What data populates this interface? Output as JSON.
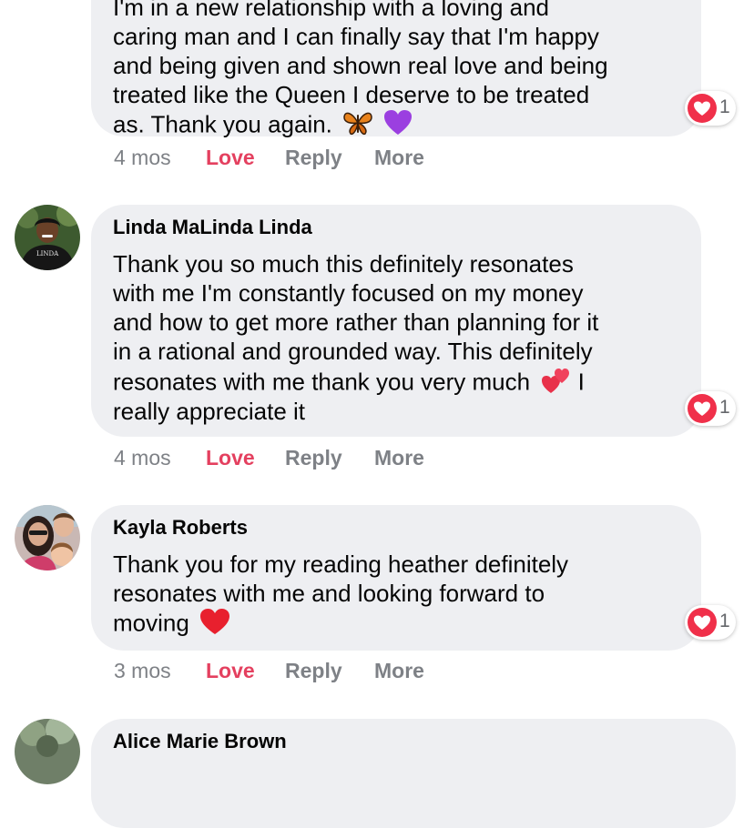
{
  "comments": [
    {
      "author": "",
      "lines": [
        "I'm in a new relationship with a loving and",
        "caring man and I can finally say that I'm happy",
        "and being given and shown real love and being",
        "treated like the Queen I deserve to be treated",
        "as. Thank you again."
      ],
      "emojis": [
        "butterfly-emoji",
        "purple-heart-emoji"
      ],
      "reactions": "1",
      "time": "4 mos"
    },
    {
      "author": "Linda MaLinda Linda",
      "lines": [
        "Thank you so much this definitely resonates",
        "with me I'm constantly focused on my money",
        "and how to get more rather than planning for it",
        "in a rational and grounded way. This definitely",
        "resonates with me thank you very much",
        "really appreciate it"
      ],
      "after_emoji": "I",
      "emojis": [
        "two-hearts-emoji"
      ],
      "reactions": "1",
      "time": "4 mos",
      "avatar_print": "LINDA"
    },
    {
      "author": "Kayla Roberts",
      "lines": [
        "Thank you for my reading heather definitely",
        "resonates with me and looking forward to",
        "moving"
      ],
      "emojis": [
        "red-heart-emoji"
      ],
      "reactions": "1",
      "time": "3 mos"
    },
    {
      "author": "Alice Marie Brown"
    }
  ],
  "actions": {
    "love": "Love",
    "reply": "Reply",
    "more": "More"
  },
  "colors": {
    "bubble": "#eeeff2",
    "love": "#e4405f",
    "meta": "#7e8186",
    "reaction_heart": "#f0304a"
  }
}
